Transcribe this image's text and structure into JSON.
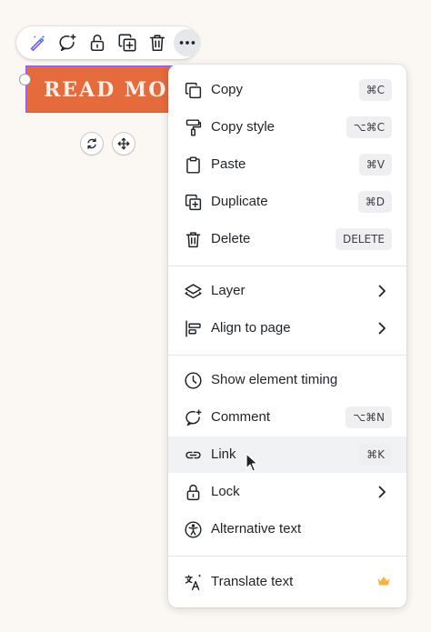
{
  "toolbar": {
    "buttons": [
      {
        "icon": "magic-edit-icon"
      },
      {
        "icon": "comment-add-icon"
      },
      {
        "icon": "lock-open-icon"
      },
      {
        "icon": "duplicate-icon"
      },
      {
        "icon": "trash-icon"
      },
      {
        "icon": "more-icon"
      }
    ]
  },
  "canvas": {
    "element_text": "READ MORE",
    "element_color": "#e56a3c",
    "selection_color": "#8b5cf6"
  },
  "menu": {
    "items": [
      {
        "label": "Copy",
        "shortcut": "⌘C",
        "icon": "copy-icon"
      },
      {
        "label": "Copy style",
        "shortcut": "⌥⌘C",
        "icon": "paint-roller-icon"
      },
      {
        "label": "Paste",
        "shortcut": "⌘V",
        "icon": "clipboard-icon"
      },
      {
        "label": "Duplicate",
        "shortcut": "⌘D",
        "icon": "duplicate-icon"
      },
      {
        "label": "Delete",
        "shortcut": "DELETE",
        "icon": "trash-icon"
      },
      {
        "label": "Layer",
        "icon": "layers-icon"
      },
      {
        "label": "Align to page",
        "icon": "align-icon"
      },
      {
        "label": "Show element timing",
        "icon": "clock-icon"
      },
      {
        "label": "Comment",
        "shortcut": "⌥⌘N",
        "icon": "comment-add-icon"
      },
      {
        "label": "Link",
        "shortcut": "⌘K",
        "icon": "link-icon"
      },
      {
        "label": "Lock",
        "icon": "lock-icon"
      },
      {
        "label": "Alternative text",
        "icon": "accessibility-icon"
      },
      {
        "label": "Translate text",
        "icon": "translate-icon"
      }
    ],
    "hovered": "Link",
    "crown_color": "#f5b43a"
  }
}
